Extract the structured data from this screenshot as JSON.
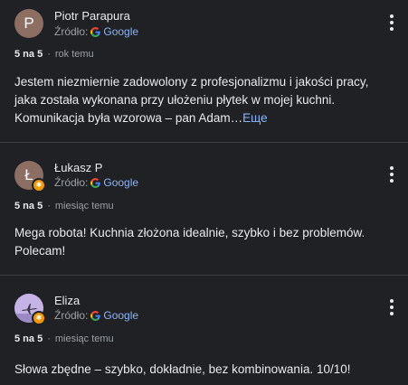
{
  "reviews": [
    {
      "name": "Piotr Parapura",
      "avatar_letter": "P",
      "avatar_color": "#8d6e63",
      "avatar_badge": false,
      "source_label": "Źródło:",
      "source_link": "Google",
      "rating": "5 na 5",
      "time": "rok temu",
      "text": "Jestem niezmiernie zadowolony z profesjonalizmu i jakości pracy, jaka została wykonana przy ułożeniu płytek w mojej kuchni. Komunikacja była wzorowa – pan Adam…",
      "more_label": "Еще"
    },
    {
      "name": "Łukasz P",
      "avatar_letter": "Ł",
      "avatar_color": "#8d6e63",
      "avatar_badge": true,
      "source_label": "Źródło:",
      "source_link": "Google",
      "rating": "5 na 5",
      "time": "miesiąc temu",
      "text": "Mega robota! Kuchnia złożona idealnie, szybko i bez problemów. Polecam!"
    },
    {
      "name": "Eliza",
      "avatar_letter": "",
      "avatar_color": "#b39ddb",
      "avatar_badge": true,
      "source_label": "Źródło:",
      "source_link": "Google",
      "rating": "5 na 5",
      "time": "miesiąc temu",
      "text": "Słowa zbędne – szybko, dokładnie, bez kombinowania. 10/10!"
    }
  ],
  "colors": {
    "background": "#202124",
    "link": "#8ab4f8",
    "badge": "#f29900"
  },
  "icons": {
    "google": "google-g-icon",
    "more": "more-vert-icon",
    "badge": "local-guide-icon"
  }
}
